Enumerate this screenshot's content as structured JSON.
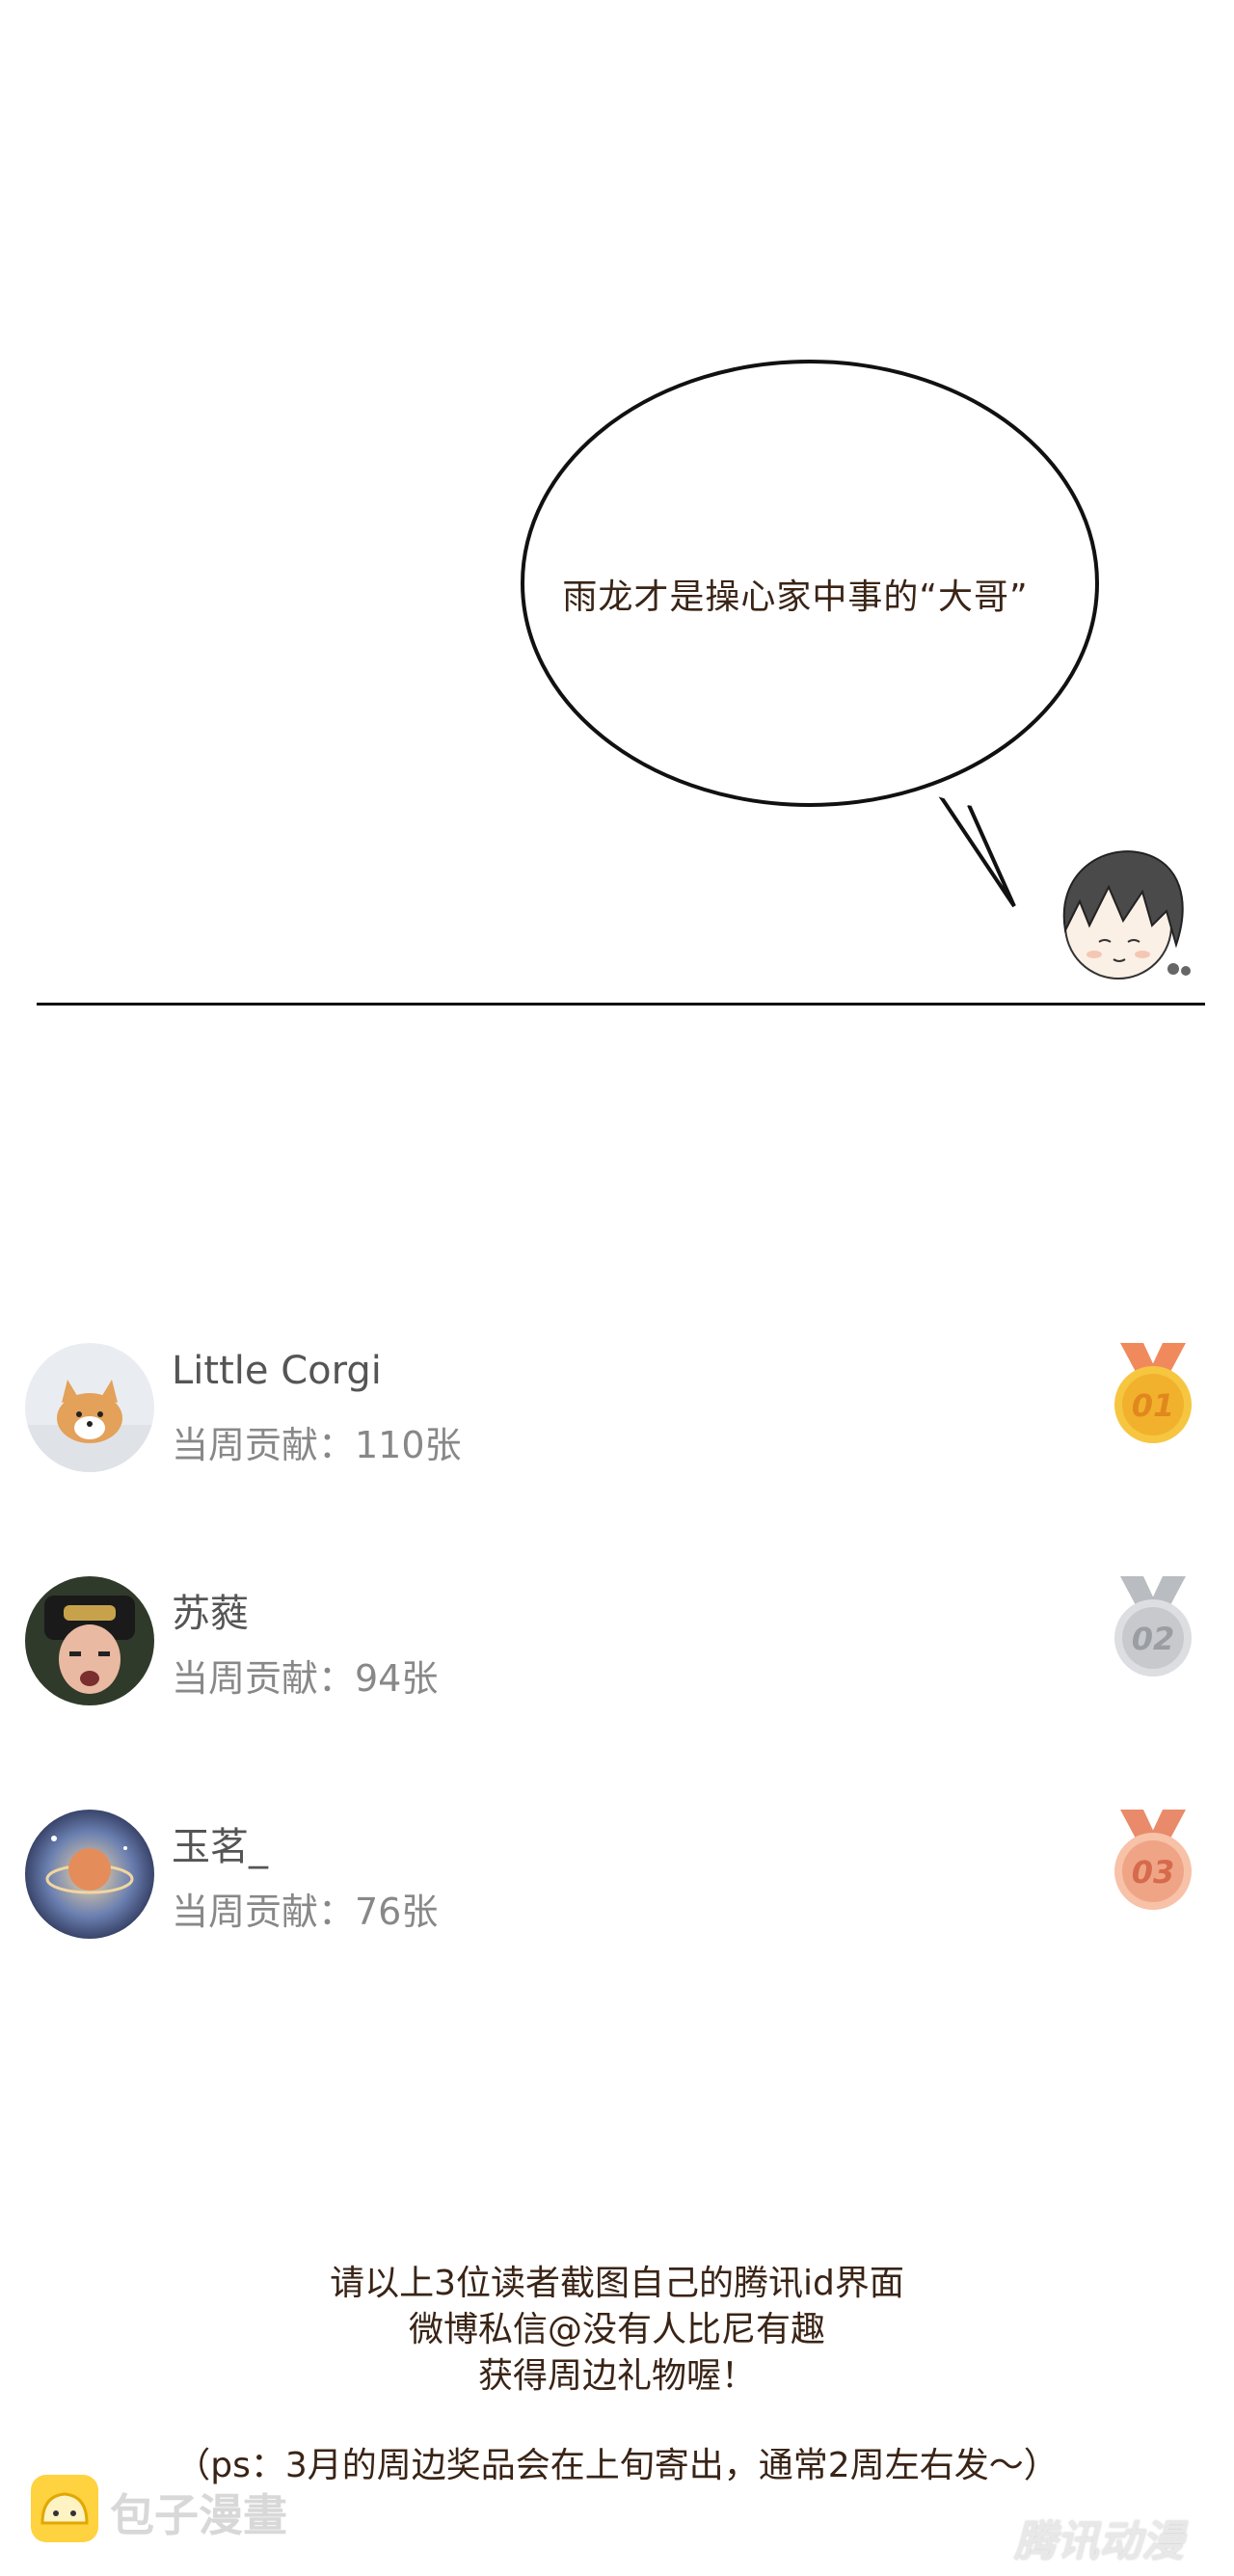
{
  "bubble": {
    "text": "雨龙才是操心家中事的“大哥”"
  },
  "ranking": [
    {
      "name": "Little Corgi",
      "contribution": "当周贡献：110张",
      "medal": "01",
      "medal_color": "#f2b12c"
    },
    {
      "name": "苏蕤",
      "contribution": "当周贡献：94张",
      "medal": "02",
      "medal_color": "#c7c9cc"
    },
    {
      "name": "玉茗_",
      "contribution": "当周贡献：76张",
      "medal": "03",
      "medal_color": "#f0a486"
    }
  ],
  "notice": {
    "line1": "请以上3位读者截图自己的腾讯id界面",
    "line2": "微博私信@没有人比尼有趣",
    "line3": "获得周边礼物喔！",
    "ps": "（ps：3月的周边奖品会在上旬寄出，通常2周左右发～）"
  },
  "watermarks": {
    "left": "包子漫畫",
    "right": "腾讯动漫"
  },
  "icons": {
    "bubble": "speech-bubble",
    "chibi": "chibi-character-head",
    "medal_gold": "gold-medal-icon",
    "medal_silver": "silver-medal-icon",
    "medal_bronze": "bronze-medal-icon"
  }
}
